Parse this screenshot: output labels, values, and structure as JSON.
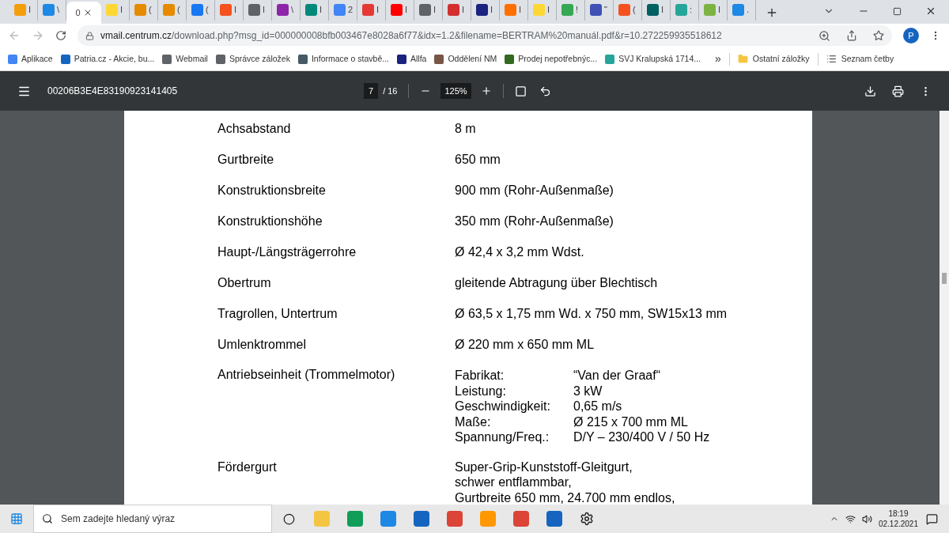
{
  "tabs": [
    {
      "label": "I",
      "color": "#f59e0b",
      "selected": false
    },
    {
      "label": "\\",
      "color": "#1e88e5",
      "selected": false
    },
    {
      "label": "0",
      "selected": true
    },
    {
      "label": "I",
      "color": "#fdd835",
      "selected": false
    },
    {
      "label": "(",
      "color": "#e68a00",
      "selected": false
    },
    {
      "label": "(",
      "color": "#e68a00",
      "selected": false
    },
    {
      "label": "(",
      "color": "#1877f2",
      "selected": false
    },
    {
      "label": "I",
      "color": "#f4511e",
      "selected": false
    },
    {
      "label": "I",
      "color": "#5f6368",
      "selected": false
    },
    {
      "label": "\\",
      "color": "#8e24aa",
      "selected": false
    },
    {
      "label": "I",
      "color": "#00897b",
      "selected": false
    },
    {
      "label": "2",
      "color": "#4285f4",
      "selected": false
    },
    {
      "label": "I",
      "color": "#e53935",
      "selected": false
    },
    {
      "label": "I",
      "color": "#ff0000",
      "selected": false
    },
    {
      "label": "I",
      "color": "#5f6368",
      "selected": false
    },
    {
      "label": "I",
      "color": "#d32f2f",
      "selected": false
    },
    {
      "label": "I",
      "color": "#1a237e",
      "selected": false
    },
    {
      "label": "I",
      "color": "#ff6f00",
      "selected": false
    },
    {
      "label": "I",
      "color": "#fdd835",
      "selected": false
    },
    {
      "label": "!",
      "color": "#34a853",
      "selected": false
    },
    {
      "label": "˜",
      "color": "#3f51b5",
      "selected": false
    },
    {
      "label": "(",
      "color": "#f4511e",
      "selected": false
    },
    {
      "label": "I",
      "color": "#006064",
      "selected": false
    },
    {
      "label": ":",
      "color": "#26a69a",
      "selected": false
    },
    {
      "label": "I",
      "color": "#7cb342",
      "selected": false
    },
    {
      "label": ".",
      "color": "#1e88e5",
      "selected": false
    }
  ],
  "address": {
    "host": "vmail.centrum.cz",
    "path": "/download.php?msg_id=000000008bfb003467e8028a6f77&idx=1.2&filename=BERTRAM%20manuál.pdf&r=10.272259935518612"
  },
  "profile": "P",
  "bookmarks": [
    {
      "label": "Aplikace",
      "color": "#4285f4"
    },
    {
      "label": "Patria.cz - Akcie, bu...",
      "color": "#1565c0"
    },
    {
      "label": "Webmail",
      "color": "#5f6368"
    },
    {
      "label": "Správce záložek",
      "color": "#5f6368"
    },
    {
      "label": "Informace o stavbě...",
      "color": "#455a64"
    },
    {
      "label": "Allfa",
      "color": "#1a237e"
    },
    {
      "label": "Oddělení NM",
      "color": "#795548"
    },
    {
      "label": "Prodej nepotřebnýc...",
      "color": "#33691e"
    },
    {
      "label": "SVJ Kralupská 1714...",
      "color": "#26a69a"
    }
  ],
  "bookmarks_more": "»",
  "other_bookmarks": "Ostatní záložky",
  "reading_list": "Seznam četby",
  "pdf_toolbar": {
    "title": "00206B3E4E83190923141405",
    "page": "7",
    "total": "/ 16",
    "zoom": "125%"
  },
  "document": [
    {
      "kind": "text",
      "label": "Achsabstand",
      "value": "8 m"
    },
    {
      "kind": "text",
      "label": "Gurtbreite",
      "value": "650 mm"
    },
    {
      "kind": "text",
      "label": "Konstruktionsbreite",
      "value": "900 mm (Rohr-Außenmaße)"
    },
    {
      "kind": "text",
      "label": "Konstruktionshöhe",
      "value": "350 mm (Rohr-Außenmaße)"
    },
    {
      "kind": "text",
      "label": "Haupt-/Längsträgerrohre",
      "value": "Ø 42,4 x 3,2 mm Wdst."
    },
    {
      "kind": "text",
      "label": "Obertrum",
      "value": "gleitende Abtragung über Blechtisch"
    },
    {
      "kind": "text",
      "label": "Tragrollen, Untertrum",
      "value": "Ø 63,5 x 1,75 mm Wd. x 750 mm, SW15x13 mm"
    },
    {
      "kind": "text",
      "label": "Umlenktrommel",
      "value": "Ø 220 mm x 650 mm ML"
    },
    {
      "kind": "specs",
      "label": "Antriebseinheit (Trommelmotor)",
      "specs": [
        {
          "key": "Fabrikat:",
          "value": "“Van der Graaf“"
        },
        {
          "key": "Leistung:",
          "value": "3 kW"
        },
        {
          "key": "Geschwindigkeit:",
          "value": "0,65 m/s"
        },
        {
          "key": "Maße:",
          "value": "Ø 215 x 700 mm ML"
        },
        {
          "key": "Spannung/Freq.:",
          "value": "D/Y – 230/400 V / 50 Hz"
        }
      ]
    },
    {
      "kind": "lines",
      "label": "Fördergurt",
      "lines": [
        "Super-Grip-Kunststoff-Gleitgurt,",
        "schwer entflammbar,",
        "Gurtbreite 650 mm, 24.700 mm endlos,"
      ]
    }
  ],
  "taskbar": {
    "search_placeholder": "Sem zadejte hledaný výraz",
    "time": "18:19",
    "date": "02.12.2021"
  }
}
